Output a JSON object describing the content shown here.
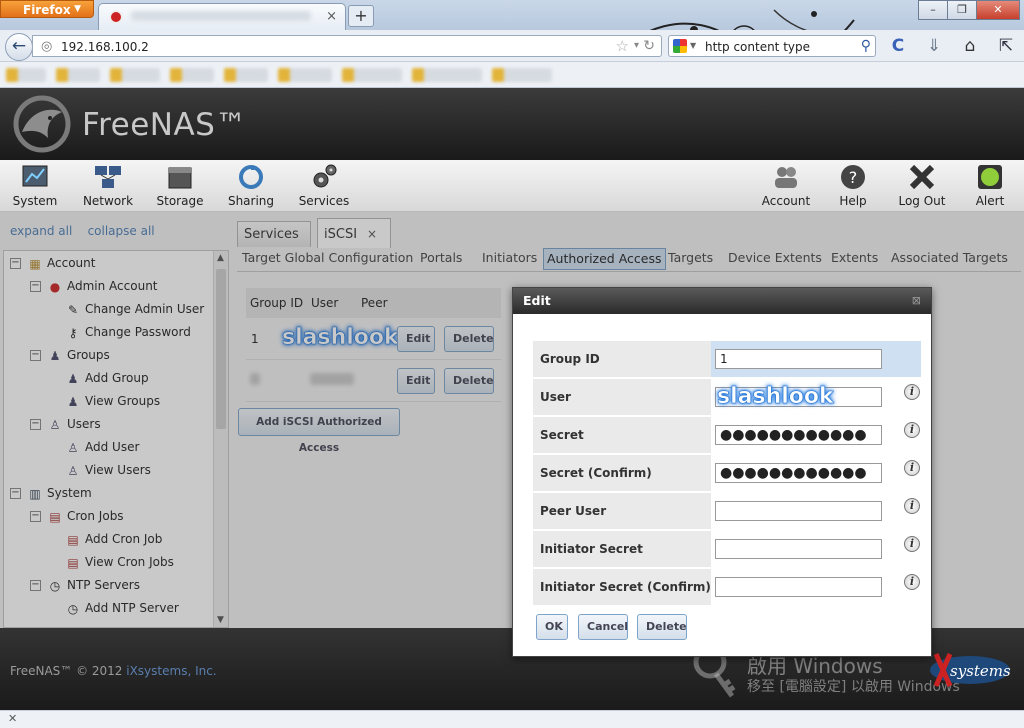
{
  "browser": {
    "menu_button": "Firefox",
    "url": "192.168.100.2",
    "search_text": "http content type",
    "new_tab": "+",
    "tab_close": "×"
  },
  "window_controls": {
    "minimize": "–",
    "restore": "❐",
    "close": "✕"
  },
  "app": {
    "logo_text": "FreeNAS™",
    "nav_left": [
      "System",
      "Network",
      "Storage",
      "Sharing",
      "Services"
    ],
    "nav_right": [
      "Account",
      "Help",
      "Log Out",
      "Alert"
    ]
  },
  "tree_controls": {
    "expand_all": "expand all",
    "collapse_all": "collapse all"
  },
  "tree": [
    {
      "label": "Account",
      "level": 0,
      "toggle": "−",
      "icon": "folder-icon"
    },
    {
      "label": "Admin Account",
      "level": 1,
      "toggle": "−",
      "icon": "user-icon"
    },
    {
      "label": "Change Admin User",
      "level": 2,
      "icon": "edit-user-icon"
    },
    {
      "label": "Change Password",
      "level": 2,
      "icon": "key-icon"
    },
    {
      "label": "Groups",
      "level": 1,
      "toggle": "−",
      "icon": "group-icon"
    },
    {
      "label": "Add Group",
      "level": 2,
      "icon": "add-group-icon"
    },
    {
      "label": "View Groups",
      "level": 2,
      "icon": "view-groups-icon"
    },
    {
      "label": "Users",
      "level": 1,
      "toggle": "−",
      "icon": "user-icon"
    },
    {
      "label": "Add User",
      "level": 2,
      "icon": "add-user-icon"
    },
    {
      "label": "View Users",
      "level": 2,
      "icon": "view-users-icon"
    },
    {
      "label": "System",
      "level": 0,
      "toggle": "−",
      "icon": "system-icon"
    },
    {
      "label": "Cron Jobs",
      "level": 1,
      "toggle": "−",
      "icon": "calendar-icon"
    },
    {
      "label": "Add Cron Job",
      "level": 2,
      "icon": "add-cron-icon"
    },
    {
      "label": "View Cron Jobs",
      "level": 2,
      "icon": "view-cron-icon"
    },
    {
      "label": "NTP Servers",
      "level": 1,
      "toggle": "−",
      "icon": "clock-icon"
    },
    {
      "label": "Add NTP Server",
      "level": 2,
      "icon": "add-ntp-icon"
    }
  ],
  "tabs": [
    {
      "label": "Services",
      "active": false
    },
    {
      "label": "iSCSI",
      "active": true,
      "close": "×"
    }
  ],
  "subtabs": [
    "Target Global Configuration",
    "Portals",
    "Initiators",
    "Authorized Access",
    "Targets",
    "Device Extents",
    "Extents",
    "Associated Targets"
  ],
  "active_subtab": "Authorized Access",
  "table": {
    "headers": [
      "Group ID",
      "User",
      "Peer"
    ],
    "rows": [
      {
        "group_id": "1",
        "user": "slashlook",
        "edit": "Edit",
        "delete": "Delete"
      },
      {
        "edit": "Edit",
        "delete": "Delete"
      }
    ],
    "add_button": "Add iSCSI Authorized Access"
  },
  "dialog": {
    "title": "Edit",
    "close": "⊠",
    "fields": [
      {
        "label": "Group ID",
        "value": "1",
        "info": false
      },
      {
        "label": "User",
        "value": "",
        "overlay": "slashlook",
        "info": true
      },
      {
        "label": "Secret",
        "value": "●●●●●●●●●●●●",
        "info": true
      },
      {
        "label": "Secret (Confirm)",
        "value": "●●●●●●●●●●●●",
        "info": true
      },
      {
        "label": "Peer User",
        "value": "",
        "info": true
      },
      {
        "label": "Initiator Secret",
        "value": "",
        "info": true
      },
      {
        "label": "Initiator Secret (Confirm)",
        "value": "",
        "info": true
      }
    ],
    "buttons": {
      "ok": "OK",
      "cancel": "Cancel",
      "delete": "Delete"
    }
  },
  "footer": {
    "copyright": "FreeNAS™ © 2012 ",
    "company": "iXsystems, Inc.",
    "watermark_line1": "啟用 Windows",
    "watermark_line2": "移至 [電腦設定] 以啟用 Windows",
    "ix_logo": "systems"
  },
  "colors": {
    "accent": "#4d7eb6",
    "header_dark": "#1a1a1a",
    "active_subtab": "#cfdff0",
    "firefox_orange": "#e2701a"
  }
}
